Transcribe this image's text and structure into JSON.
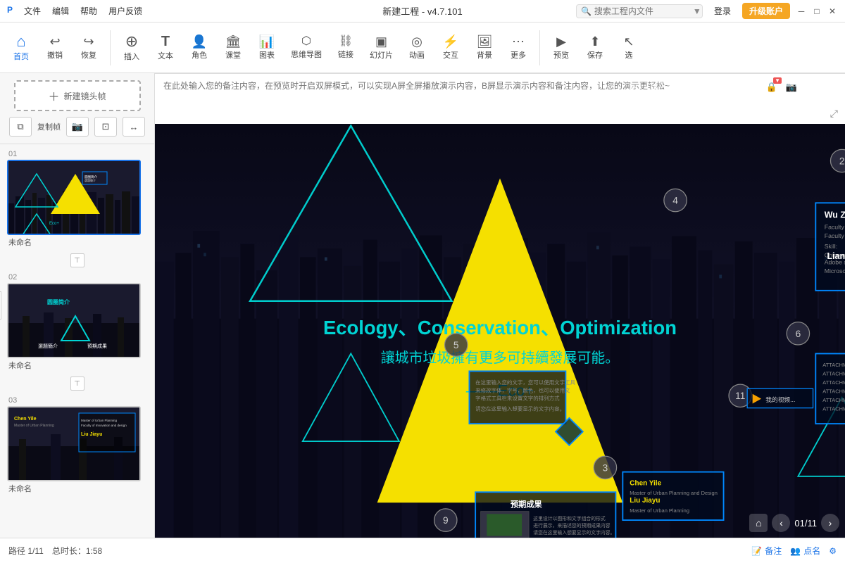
{
  "app": {
    "title": "新建工程 - v4.7.101",
    "search_placeholder": "搜索工程内文件"
  },
  "title_bar": {
    "menu": [
      "P",
      "文件",
      "编辑",
      "帮助",
      "用户反馈"
    ],
    "login": "登录",
    "upgrade": "升级账户",
    "win_controls": [
      "─",
      "□",
      "×"
    ]
  },
  "toolbar": {
    "items": [
      {
        "id": "home",
        "icon": "⌂",
        "label": "首页",
        "active": true
      },
      {
        "id": "undo",
        "icon": "↩",
        "label": "撤销"
      },
      {
        "id": "redo",
        "icon": "↪",
        "label": "恢复"
      },
      {
        "id": "insert",
        "icon": "⊕",
        "label": "插入"
      },
      {
        "id": "text",
        "icon": "T",
        "label": "文本"
      },
      {
        "id": "character",
        "icon": "👤",
        "label": "角色"
      },
      {
        "id": "classroom",
        "icon": "🏫",
        "label": "课堂"
      },
      {
        "id": "chart",
        "icon": "📊",
        "label": "图表"
      },
      {
        "id": "mindmap",
        "icon": "🔗",
        "label": "思维导图"
      },
      {
        "id": "link",
        "icon": "🔗",
        "label": "链接"
      },
      {
        "id": "slide",
        "icon": "▣",
        "label": "幻灯片"
      },
      {
        "id": "animate",
        "icon": "▶",
        "label": "动画"
      },
      {
        "id": "interact",
        "icon": "⚡",
        "label": "交互"
      },
      {
        "id": "bg",
        "icon": "🖼",
        "label": "背景"
      },
      {
        "id": "more",
        "icon": "···",
        "label": "更多"
      },
      {
        "id": "preview",
        "icon": "👁",
        "label": "预览"
      },
      {
        "id": "save",
        "icon": "💾",
        "label": "保存"
      },
      {
        "id": "select",
        "icon": "↖",
        "label": "选"
      }
    ]
  },
  "sidebar": {
    "new_frame_label": "新建镜头帧",
    "actions": [
      "复制帧",
      "📷",
      "⊡",
      "↔"
    ],
    "slides": [
      {
        "number": "01",
        "name": "未命名",
        "active": true,
        "content_type": "main"
      },
      {
        "number": "02",
        "name": "未命名",
        "active": false,
        "content_type": "intro"
      },
      {
        "number": "03",
        "name": "未命名",
        "active": false,
        "content_type": "person"
      }
    ]
  },
  "canvas": {
    "main_text_line1": "Ecology、Conservation、Optimization",
    "main_text_line2": "讓城市垃圾擁有更多可持續發展可能。",
    "main_text_line3": "——Eco+",
    "nav_page": "01/11"
  },
  "notes": {
    "placeholder": "在此处输入您的备注内容，在预览时开启双屏模式，可以实现A屏全屏播放演示内容，B屏显示演示内容和备注内容，让您的演示更轻松~"
  },
  "bottom_bar": {
    "path": "路径 1/11",
    "duration": "总时长：1:58",
    "notes_action": "备注",
    "callout_action": "点名"
  },
  "canvas_tools": [
    "⌂",
    "↺",
    "□",
    "□",
    "⊕",
    "⊖",
    "≡",
    "🔒",
    "📷",
    "⊡",
    "↔"
  ],
  "node_labels": {
    "wu_name": "Wu Zhengtao",
    "liang_name": "Liang Ran",
    "chen_name": "Chen Yile",
    "liu_name": "Liu Jiayu",
    "num_2": "2",
    "num_3": "3",
    "num_4": "4",
    "num_5": "5",
    "num_6": "6",
    "num_9": "9",
    "num_11": "11",
    "preview_label": "预期成果",
    "intro_title": "圆圈简介",
    "intro_sub1": "選題簡介",
    "intro_sub2": "預期成果"
  }
}
